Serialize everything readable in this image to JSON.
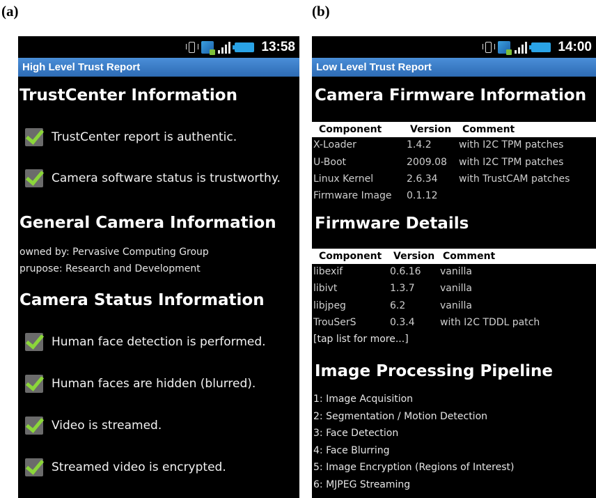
{
  "panel_a": {
    "label": "(a)",
    "status_time": "13:58",
    "title": "High Level Trust Report",
    "section_trustcenter": "TrustCenter Information",
    "trust_checks": [
      "TrustCenter report is authentic.",
      "Camera software status is trustworthy."
    ],
    "section_general": "General Camera Information",
    "owned_by": "owned by: Pervasive Computing Group",
    "purpose": "prupose: Research and Development",
    "section_status": "Camera Status Information",
    "status_checks": [
      "Human face detection is performed.",
      "Human faces are hidden (blurred).",
      "Video is streamed.",
      "Streamed video is encrypted."
    ]
  },
  "panel_b": {
    "label": "(b)",
    "status_time": "14:00",
    "title": "Low Level Trust Report",
    "section_firmware_info": "Camera Firmware Information",
    "firmware_headers": [
      "Component",
      "Version",
      "Comment"
    ],
    "firmware_rows": [
      [
        "X-Loader",
        "1.4.2",
        "with I2C TPM patches"
      ],
      [
        "U-Boot",
        "2009.08",
        "with I2C TPM patches"
      ],
      [
        "Linux Kernel",
        "2.6.34",
        "with TrustCAM patches"
      ],
      [
        "Firmware Image",
        "0.1.12",
        ""
      ]
    ],
    "section_firmware_details": "Firmware Details",
    "details_headers": [
      "Component",
      "Version",
      "Comment"
    ],
    "details_rows": [
      [
        "libexif",
        "0.6.16",
        "vanilla"
      ],
      [
        "libivt",
        "1.3.7",
        "vanilla"
      ],
      [
        "libjpeg",
        "6.2",
        "vanilla"
      ],
      [
        "TrouSerS",
        "0.3.4",
        "with I2C TDDL patch"
      ]
    ],
    "tap_more": "[tap list for more...]",
    "section_pipeline": "Image Processing Pipeline",
    "pipeline": [
      "1: Image Acquisition",
      "2: Segmentation / Motion Detection",
      "3: Face Detection",
      "4: Face Blurring",
      "5: Image Encryption (Regions of Interest)",
      "6: MJPEG Streaming"
    ]
  }
}
